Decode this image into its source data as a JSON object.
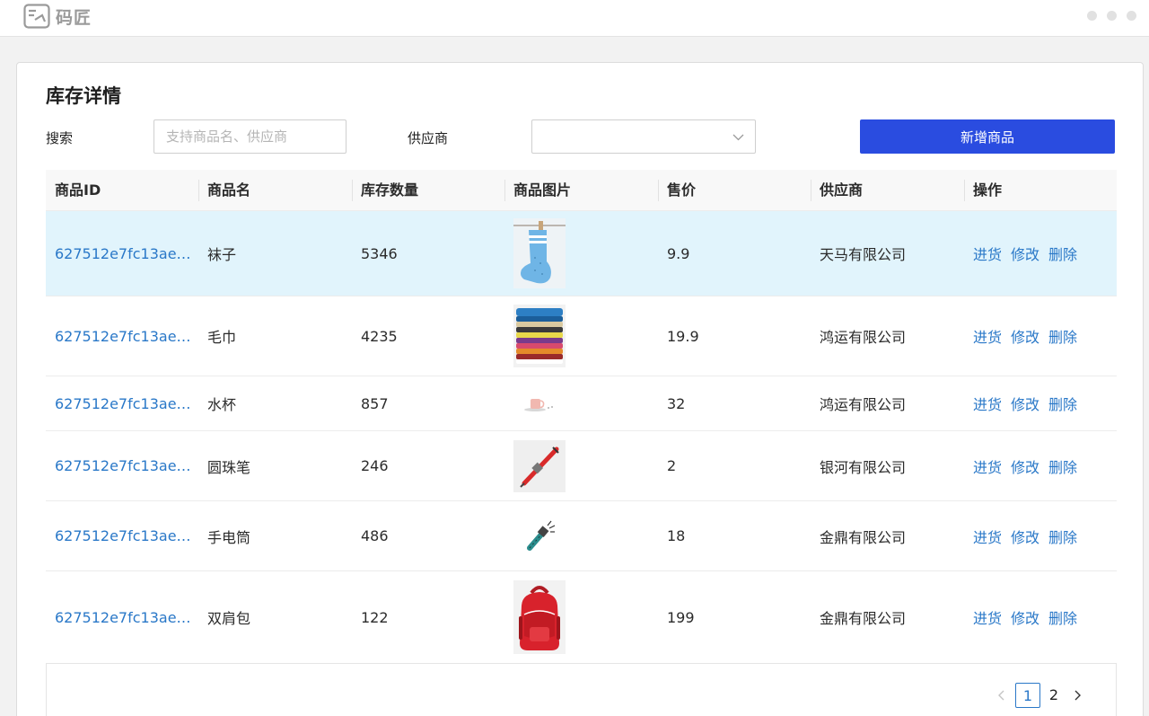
{
  "app": {
    "brand": "码匠"
  },
  "page": {
    "title": "库存详情"
  },
  "filters": {
    "search_label": "搜索",
    "search_placeholder": "支持商品名、供应商",
    "supplier_label": "供应商",
    "supplier_value": ""
  },
  "toolbar": {
    "add_label": "新增商品"
  },
  "table": {
    "columns": [
      "商品ID",
      "商品名",
      "库存数量",
      "商品图片",
      "售价",
      "供应商",
      "操作"
    ],
    "actions": [
      "进货",
      "修改",
      "删除"
    ],
    "rows": [
      {
        "id": "627512e7fc13ae…",
        "name": "袜子",
        "stock": "5346",
        "image_icon": "sock-image",
        "price": "9.9",
        "supplier": "天马有限公司",
        "selected": true
      },
      {
        "id": "627512e7fc13ae…",
        "name": "毛巾",
        "stock": "4235",
        "image_icon": "towel-stack-image",
        "price": "19.9",
        "supplier": "鸿运有限公司",
        "selected": false
      },
      {
        "id": "627512e7fc13ae…",
        "name": "水杯",
        "stock": "857",
        "image_icon": "cup-image",
        "price": "32",
        "supplier": "鸿运有限公司",
        "selected": false
      },
      {
        "id": "627512e7fc13ae…",
        "name": "圆珠笔",
        "stock": "246",
        "image_icon": "pen-image",
        "price": "2",
        "supplier": "银河有限公司",
        "selected": false
      },
      {
        "id": "627512e7fc13ae…",
        "name": "手电筒",
        "stock": "486",
        "image_icon": "flashlight-image",
        "price": "18",
        "supplier": "金鼎有限公司",
        "selected": false
      },
      {
        "id": "627512e7fc13ae…",
        "name": "双肩包",
        "stock": "122",
        "image_icon": "backpack-image",
        "price": "199",
        "supplier": "金鼎有限公司",
        "selected": false
      }
    ]
  },
  "pagination": {
    "pages": [
      "1",
      "2"
    ],
    "current": "1"
  },
  "colors": {
    "primary": "#2a4ce0",
    "link": "#2a78c8",
    "selected_row": "#e1f4fc"
  }
}
